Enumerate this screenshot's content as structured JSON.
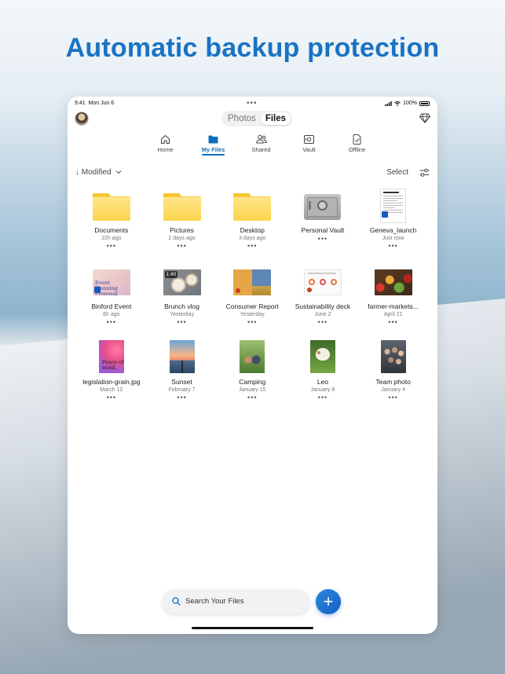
{
  "headline": "Automatic backup protection",
  "status_bar": {
    "time": "9:41",
    "date": "Mon Jun 6",
    "battery": "100%"
  },
  "switcher": {
    "photos": "Photos",
    "files": "Files",
    "active": "Files"
  },
  "nav": {
    "items": [
      {
        "label": "Home",
        "icon": "home-icon",
        "active": false
      },
      {
        "label": "My Files",
        "icon": "folder-icon",
        "active": true
      },
      {
        "label": "Shared",
        "icon": "people-icon",
        "active": false
      },
      {
        "label": "Vault",
        "icon": "vault-icon",
        "active": false
      },
      {
        "label": "Offline",
        "icon": "offline-icon",
        "active": false
      }
    ]
  },
  "toolbar": {
    "sort_label": "Modified",
    "select_label": "Select"
  },
  "files": [
    {
      "name": "Documents",
      "date": "22h ago",
      "type": "folder"
    },
    {
      "name": "Pictures",
      "date": "2 days ago",
      "type": "folder"
    },
    {
      "name": "Desktop",
      "date": "3 days ago",
      "type": "folder"
    },
    {
      "name": "Personal Vault",
      "date": "",
      "type": "vault"
    },
    {
      "name": "Geneva_launch",
      "date": "Just now",
      "type": "word-doc"
    },
    {
      "name": "Binford Event",
      "date": "6h ago",
      "type": "word-doc",
      "thumb_text": "Event Planning Proposal"
    },
    {
      "name": "Brunch vlog",
      "date": "Yesterday",
      "type": "video",
      "duration": "1:40"
    },
    {
      "name": "Consumer Report",
      "date": "Yesterday",
      "type": "powerpoint"
    },
    {
      "name": "Sustainability deck",
      "date": "June 2",
      "type": "powerpoint"
    },
    {
      "name": "farmer-markets...",
      "date": "April 21",
      "type": "image"
    },
    {
      "name": "legislation-grain.jpg",
      "date": "March 12",
      "type": "image",
      "thumb_text": "Peace of mind."
    },
    {
      "name": "Sunset",
      "date": "February 7",
      "type": "image"
    },
    {
      "name": "Camping",
      "date": "January 15",
      "type": "image"
    },
    {
      "name": "Leo",
      "date": "January 8",
      "type": "image"
    },
    {
      "name": "Team photo",
      "date": "January 4",
      "type": "image"
    }
  ],
  "more_label": "•••",
  "search": {
    "placeholder": "Search Your Files"
  },
  "fab": {
    "label": "+"
  },
  "colors": {
    "accent": "#0f6cbd",
    "headline": "#1a73c4",
    "folder": "#fcd54c"
  }
}
